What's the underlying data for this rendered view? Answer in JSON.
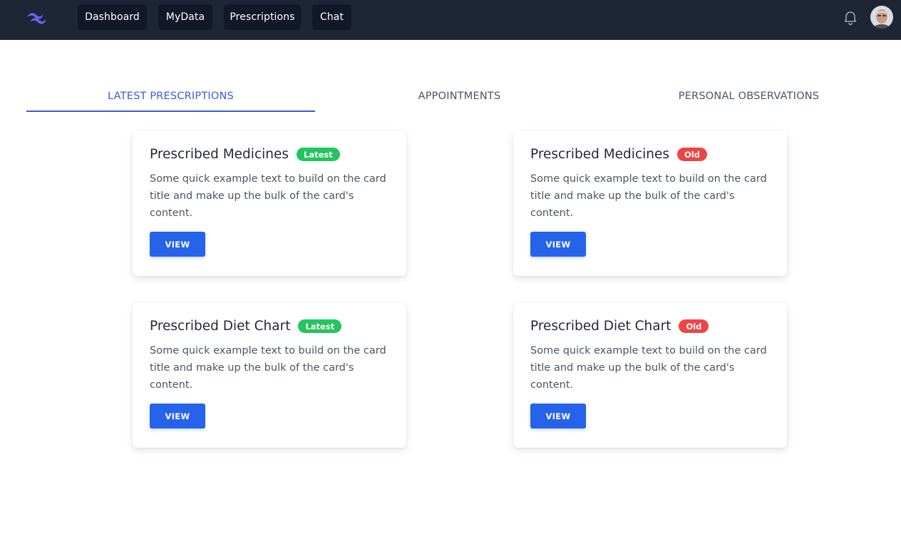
{
  "nav": {
    "items": [
      {
        "label": "Dashboard"
      },
      {
        "label": "MyData"
      },
      {
        "label": "Prescriptions"
      },
      {
        "label": "Chat"
      }
    ],
    "logo_icon": "tailwind-wave-logo",
    "notification_icon": "bell-icon",
    "avatar_icon": "user-avatar"
  },
  "tabs": [
    {
      "label": "LATEST PRESCRIPTIONS",
      "active": true
    },
    {
      "label": "APPOINTMENTS",
      "active": false
    },
    {
      "label": "PERSONAL OBSERVATIONS",
      "active": false
    }
  ],
  "cards": [
    {
      "title": "Prescribed Medicines",
      "badge": "Latest",
      "text": "Some quick example text to build on the card title and make up the bulk of the card's content.",
      "button": "VIEW"
    },
    {
      "title": "Prescribed Medicines",
      "badge": "Old",
      "text": "Some quick example text to build on the card title and make up the bulk of the card's content.",
      "button": "VIEW"
    },
    {
      "title": "Prescribed Diet Chart",
      "badge": "Latest",
      "text": "Some quick example text to build on the card title and make up the bulk of the card's content.",
      "button": "VIEW"
    },
    {
      "title": "Prescribed Diet Chart",
      "badge": "Old",
      "text": "Some quick example text to build on the card title and make up the bulk of the card's content.",
      "button": "VIEW"
    }
  ],
  "colors": {
    "navbar_bg": "#1e2535",
    "nav_button_bg": "#111827",
    "accent": "#3b5bdb",
    "primary_button": "#2563eb",
    "badge_latest": "#22c55e",
    "badge_old": "#ef4444"
  }
}
